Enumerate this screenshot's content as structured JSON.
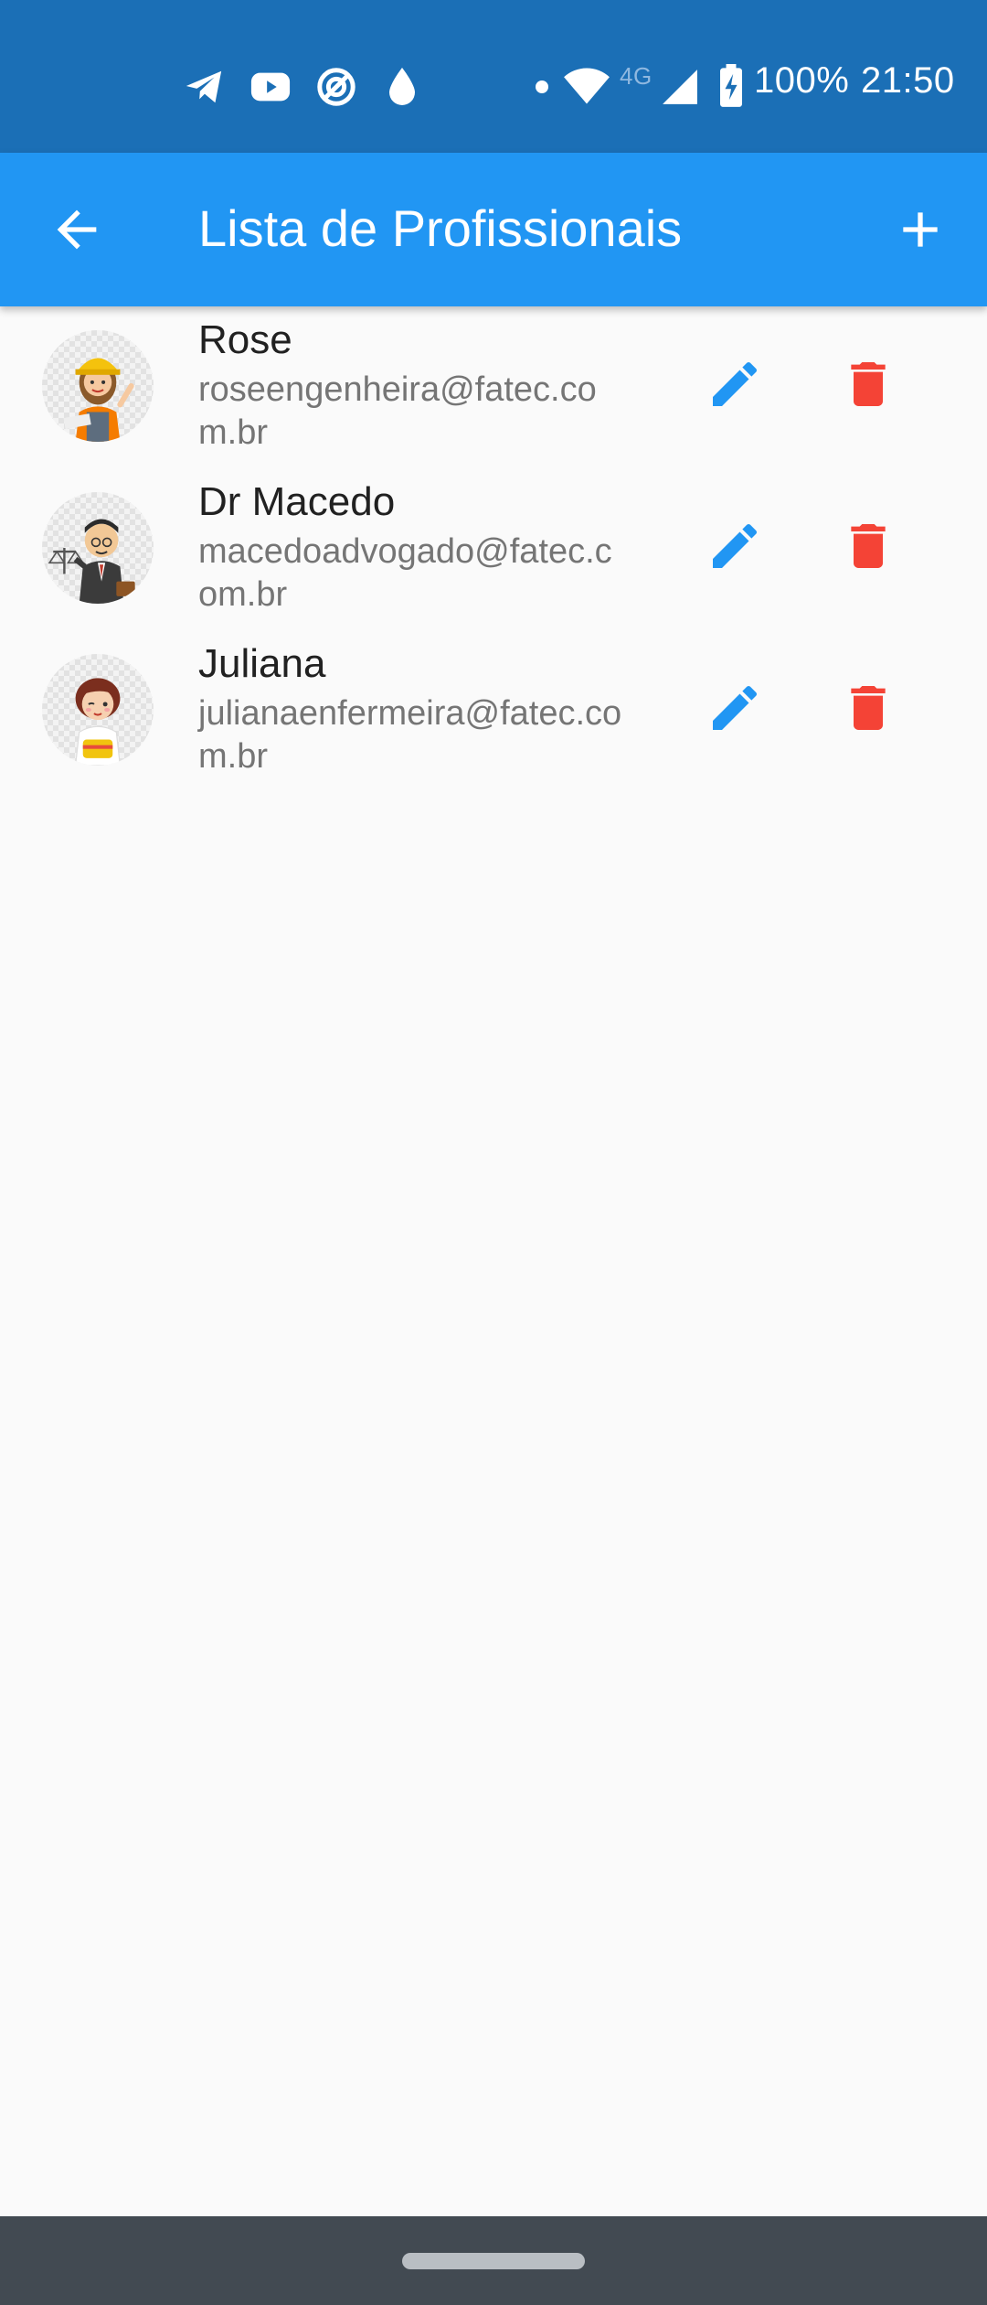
{
  "status_bar": {
    "battery": "100%",
    "time": "21:50",
    "network": "4G",
    "icons": [
      "telegram-icon",
      "youtube-icon",
      "app-icon",
      "drop-icon",
      "dot-icon",
      "wifi-icon",
      "signal-icon",
      "battery-charging-icon"
    ]
  },
  "appbar": {
    "title": "Lista de Profissionais",
    "back_icon": "arrow-back-icon",
    "add_icon": "add-icon",
    "color": "#2196f3"
  },
  "professionals": [
    {
      "name": "Rose",
      "email": "roseengenheira@fatec.com.br",
      "avatar": "engineer-avatar"
    },
    {
      "name": "Dr Macedo",
      "email": "macedoadvogado@fatec.com.br",
      "avatar": "lawyer-avatar"
    },
    {
      "name": "Juliana",
      "email": "julianaenfermeira@fatec.com.br",
      "avatar": "nurse-avatar"
    }
  ],
  "actions": {
    "edit_icon": "edit-icon",
    "delete_icon": "delete-icon",
    "edit_color": "#2196f3",
    "delete_color": "#f44336"
  }
}
